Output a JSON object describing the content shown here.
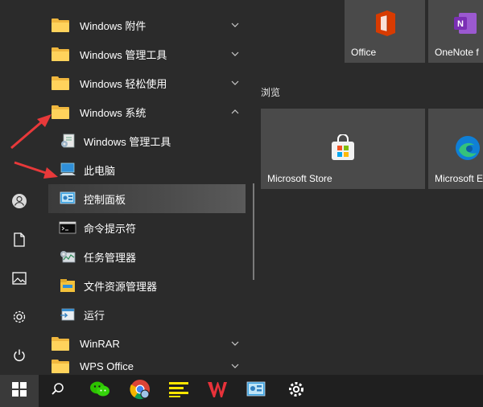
{
  "applist": {
    "items": [
      {
        "label": "Windows 附件",
        "type": "folder",
        "expanded": false
      },
      {
        "label": "Windows 管理工具",
        "type": "folder",
        "expanded": false
      },
      {
        "label": "Windows 轻松使用",
        "type": "folder",
        "expanded": false
      },
      {
        "label": "Windows 系统",
        "type": "folder",
        "expanded": true
      },
      {
        "label": "Windows 管理工具",
        "type": "app",
        "icon": "admin-tools-icon"
      },
      {
        "label": "此电脑",
        "type": "app",
        "icon": "this-pc-icon"
      },
      {
        "label": "控制面板",
        "type": "app",
        "icon": "control-panel-icon",
        "selected": true
      },
      {
        "label": "命令提示符",
        "type": "app",
        "icon": "command-prompt-icon"
      },
      {
        "label": "任务管理器",
        "type": "app",
        "icon": "task-manager-icon"
      },
      {
        "label": "文件资源管理器",
        "type": "app",
        "icon": "file-explorer-icon"
      },
      {
        "label": "运行",
        "type": "app",
        "icon": "run-icon"
      },
      {
        "label": "WinRAR",
        "type": "folder",
        "expanded": false
      },
      {
        "label": "WPS Office",
        "type": "folder",
        "expanded": false
      }
    ]
  },
  "tiles": {
    "group_title": "浏览",
    "office": "Office",
    "onenote": "OneNote f",
    "store": "Microsoft Store",
    "edge": "Microsoft E"
  },
  "rail": [
    "user-icon",
    "document-icon",
    "pictures-icon",
    "settings-icon",
    "power-icon"
  ],
  "taskbar": [
    "windows-start-icon",
    "search-icon",
    "wechat-icon",
    "chrome-icon",
    "notes-icon",
    "wps-icon",
    "control-panel-icon",
    "settings-icon"
  ],
  "colors": {
    "accent_arrow": "#e8393a",
    "folder": "#ffd35c",
    "tile": "#4a4a4a"
  }
}
